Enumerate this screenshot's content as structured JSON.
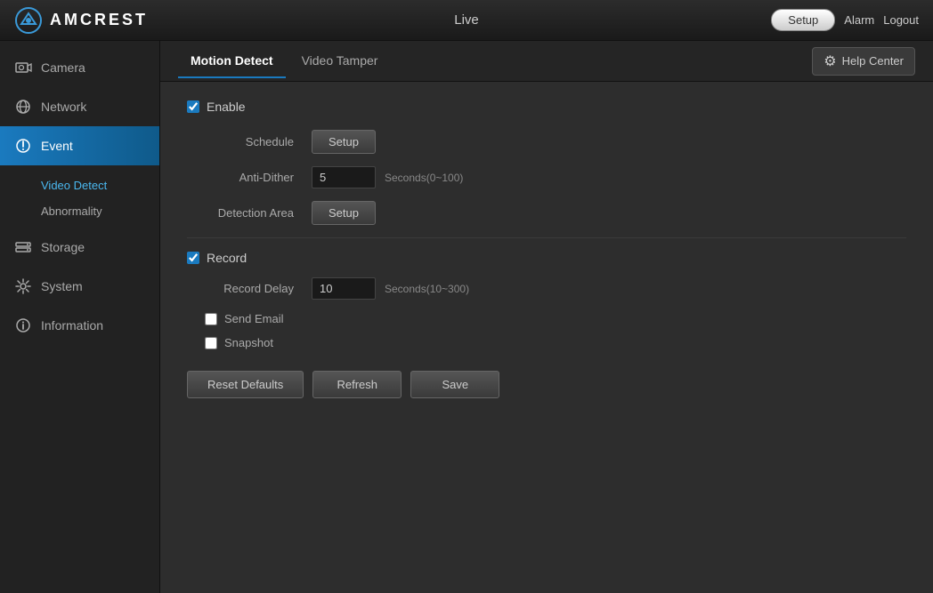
{
  "topbar": {
    "logo_text": "AMCREST",
    "center_label": "Live",
    "setup_label": "Setup",
    "alarm_label": "Alarm",
    "logout_label": "Logout"
  },
  "sidebar": {
    "items": [
      {
        "id": "camera",
        "label": "Camera",
        "icon": "camera"
      },
      {
        "id": "network",
        "label": "Network",
        "icon": "network"
      },
      {
        "id": "event",
        "label": "Event",
        "icon": "event",
        "active": true
      },
      {
        "id": "storage",
        "label": "Storage",
        "icon": "storage"
      },
      {
        "id": "system",
        "label": "System",
        "icon": "system"
      },
      {
        "id": "information",
        "label": "Information",
        "icon": "info"
      }
    ],
    "sub_items": [
      {
        "id": "video-detect",
        "label": "Video Detect",
        "active": true
      },
      {
        "id": "abnormality",
        "label": "Abnormality",
        "active": false
      }
    ]
  },
  "tabs": [
    {
      "id": "motion-detect",
      "label": "Motion Detect",
      "active": true
    },
    {
      "id": "video-tamper",
      "label": "Video Tamper",
      "active": false
    }
  ],
  "help_center": "Help Center",
  "form": {
    "enable_label": "Enable",
    "enable_checked": true,
    "schedule_label": "Schedule",
    "schedule_btn": "Setup",
    "anti_dither_label": "Anti-Dither",
    "anti_dither_value": "5",
    "anti_dither_hint": "Seconds(0~100)",
    "detection_area_label": "Detection Area",
    "detection_area_btn": "Setup",
    "record_label": "Record",
    "record_checked": true,
    "record_delay_label": "Record Delay",
    "record_delay_value": "10",
    "record_delay_hint": "Seconds(10~300)",
    "send_email_label": "Send Email",
    "send_email_checked": false,
    "snapshot_label": "Snapshot",
    "snapshot_checked": false
  },
  "buttons": {
    "reset_defaults": "Reset Defaults",
    "refresh": "Refresh",
    "save": "Save"
  }
}
